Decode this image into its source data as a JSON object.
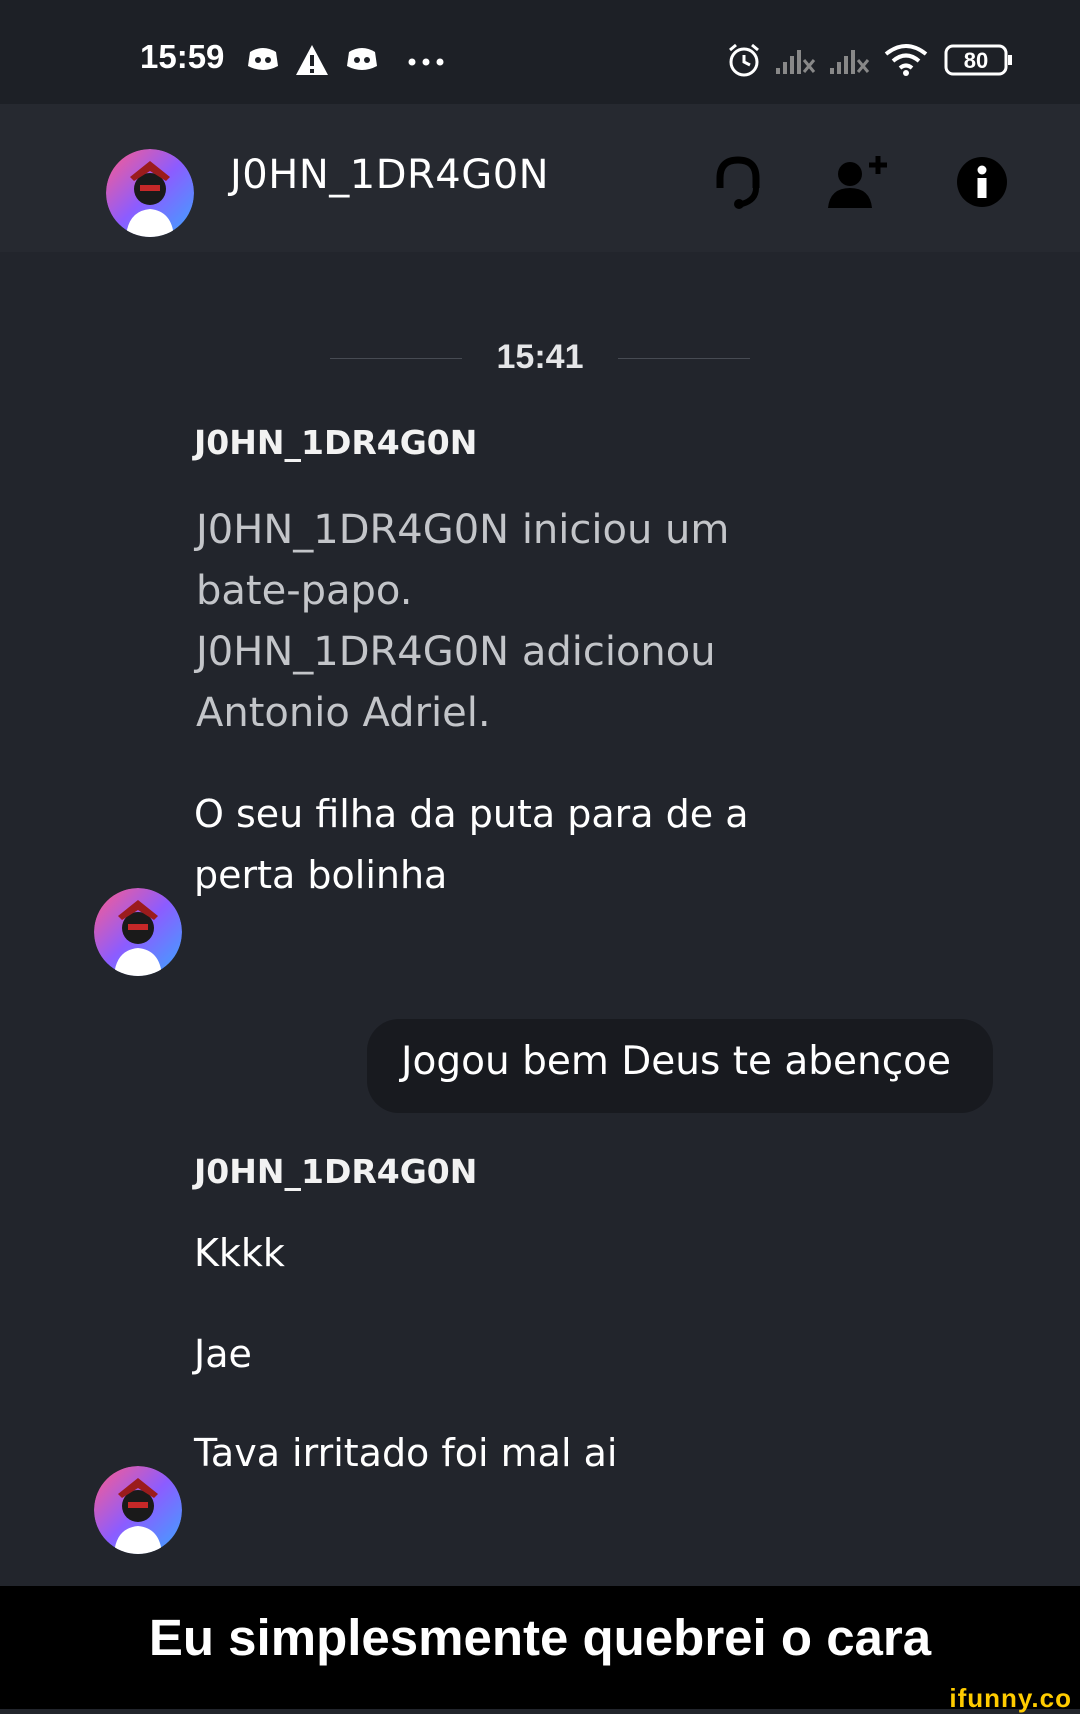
{
  "status_bar": {
    "time": "15:59",
    "icons": [
      "discord-icon",
      "warning-icon",
      "discord-icon",
      "more-dots-icon",
      "alarm-icon",
      "signal-icon",
      "signal-icon",
      "wifi-icon",
      "battery-icon"
    ],
    "battery": "80"
  },
  "header": {
    "title": "J0HN_1DR4G0N",
    "icons": [
      "headset-icon",
      "add-friend-icon",
      "info-icon"
    ]
  },
  "chat": {
    "timestamp": "15:41",
    "groups": [
      {
        "sender": "J0HN_1DR4G0N",
        "system_lines": [
          "J0HN_1DR4G0N iniciou um",
          "bate-papo.",
          "J0HN_1DR4G0N adicionou",
          "Antonio Adriel."
        ],
        "message_lines": [
          "O seu filha da puta para de a",
          "perta bolinha"
        ]
      },
      {
        "own_message": "Jogou bem Deus te abençoe"
      },
      {
        "sender": "J0HN_1DR4G0N",
        "messages": [
          "Kkkk",
          "Jae",
          "Tava irritado foi mal ai"
        ]
      }
    ]
  },
  "caption": "Eu simplesmente quebrei o cara",
  "watermark": "ifunny.co",
  "colors": {
    "background": "#22252c",
    "header": "#262930",
    "bubble": "#181a1f",
    "caption_bg": "#000000",
    "watermark": "#ffcc00"
  }
}
